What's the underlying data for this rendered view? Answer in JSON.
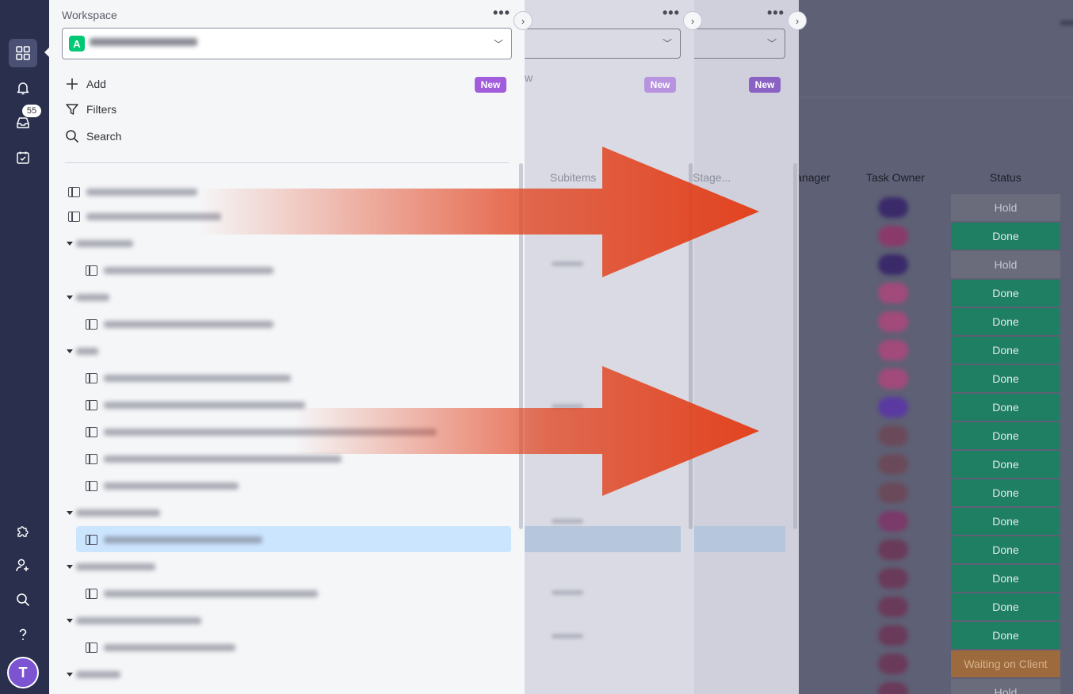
{
  "rail": {
    "inbox_badge": "55",
    "avatar_initial": "T"
  },
  "workspace": {
    "title": "Workspace",
    "selected_letter": "A",
    "actions": [
      {
        "label": "Add",
        "badge": "New"
      },
      {
        "label": "Filters"
      },
      {
        "label": "Search"
      }
    ]
  },
  "panels": {
    "new_badge_b": "New",
    "new_badge_c": "New",
    "ghost_text_w": "w",
    "col_subitems": "Subitems",
    "col_stage": "Stage..."
  },
  "board": {
    "headers": {
      "account_manager": "Account Manager",
      "task_owner": "Task Owner",
      "status": "Status"
    },
    "statuses": [
      "Hold",
      "Done",
      "Hold",
      "Done",
      "Done",
      "Done",
      "Done",
      "Done",
      "Done",
      "Done",
      "Done",
      "Done",
      "Done",
      "Done",
      "Done",
      "Done",
      "Waiting on Client",
      "Hold"
    ]
  },
  "colors": {
    "rail": "#292f4c",
    "done": "#00c875",
    "hold": "#c4c4c4",
    "waiting": "#fdab3d",
    "new_badge": "#a25ddc",
    "arrow": "#e2431f"
  },
  "icons": [
    "grid-icon",
    "bell-icon",
    "inbox-icon",
    "calendar-check-icon",
    "puzzle-icon",
    "add-user-icon",
    "search-icon",
    "help-icon",
    "plus-icon",
    "filter-icon",
    "board-icon",
    "chevron-down-icon"
  ]
}
